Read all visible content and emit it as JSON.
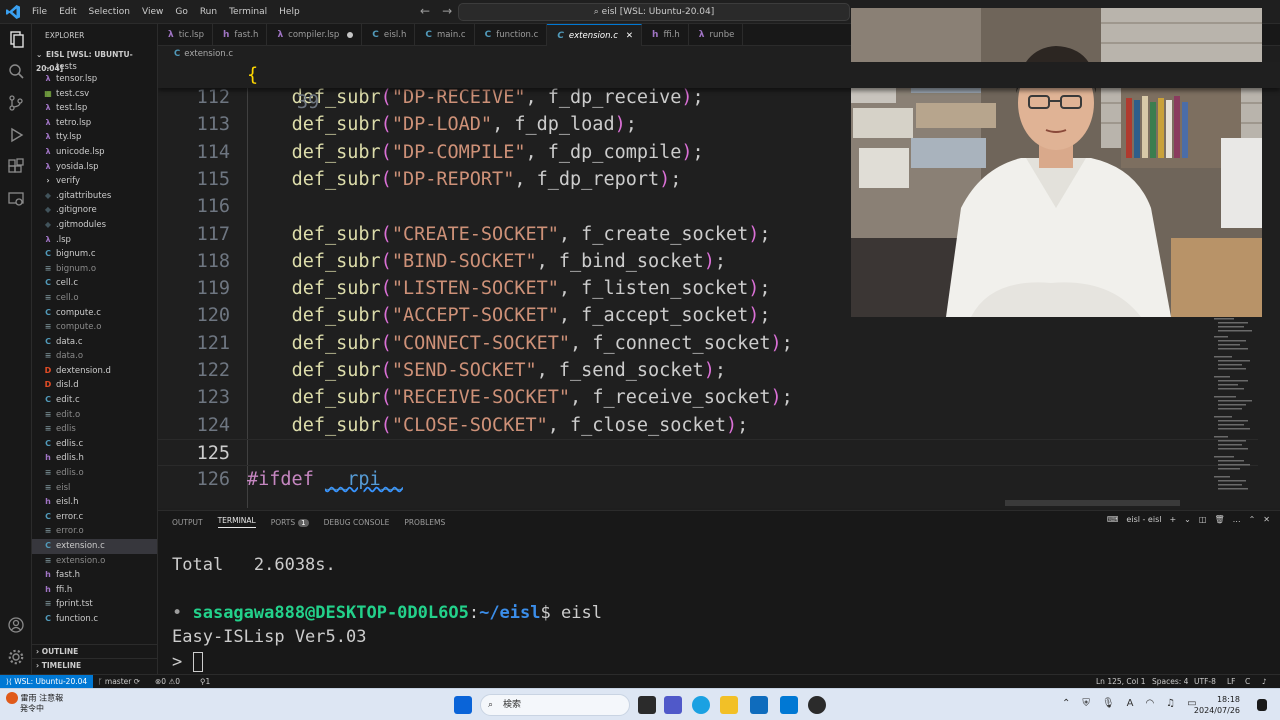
{
  "titlebar": {
    "menu": [
      "File",
      "Edit",
      "Selection",
      "View",
      "Go",
      "Run",
      "Terminal",
      "Help"
    ],
    "command_center": "eisl [WSL: Ubuntu-20.04]"
  },
  "sidebar": {
    "title": "EXPLORER",
    "workspace": "EISL [WSL: UBUNTU-20.04]",
    "folder_open": "tests",
    "items": [
      {
        "icon": "λ",
        "icon_color": "#a074c4",
        "label": "tensor.lsp",
        "dim": false
      },
      {
        "icon": "▦",
        "icon_color": "#8bc34a",
        "label": "test.csv",
        "dim": false
      },
      {
        "icon": "λ",
        "icon_color": "#a074c4",
        "label": "test.lsp",
        "dim": false
      },
      {
        "icon": "λ",
        "icon_color": "#a074c4",
        "label": "tetro.lsp",
        "dim": false
      },
      {
        "icon": "λ",
        "icon_color": "#a074c4",
        "label": "tty.lsp",
        "dim": false
      },
      {
        "icon": "λ",
        "icon_color": "#a074c4",
        "label": "unicode.lsp",
        "dim": false
      },
      {
        "icon": "λ",
        "icon_color": "#a074c4",
        "label": "yosida.lsp",
        "dim": false
      },
      {
        "icon": "›",
        "icon_color": "#cccccc",
        "label": "verify",
        "dim": false
      },
      {
        "icon": "◆",
        "icon_color": "#41535b",
        "label": ".gitattributes",
        "dim": false
      },
      {
        "icon": "◆",
        "icon_color": "#41535b",
        "label": ".gitignore",
        "dim": false
      },
      {
        "icon": "◆",
        "icon_color": "#41535b",
        "label": ".gitmodules",
        "dim": false
      },
      {
        "icon": "λ",
        "icon_color": "#a074c4",
        "label": ".lsp",
        "dim": false
      },
      {
        "icon": "C",
        "icon_color": "#519aba",
        "label": "bignum.c",
        "dim": false
      },
      {
        "icon": "≡",
        "icon_color": "#6d8086",
        "label": "bignum.o",
        "dim": true
      },
      {
        "icon": "C",
        "icon_color": "#519aba",
        "label": "cell.c",
        "dim": false
      },
      {
        "icon": "≡",
        "icon_color": "#6d8086",
        "label": "cell.o",
        "dim": true
      },
      {
        "icon": "C",
        "icon_color": "#519aba",
        "label": "compute.c",
        "dim": false
      },
      {
        "icon": "≡",
        "icon_color": "#6d8086",
        "label": "compute.o",
        "dim": true
      },
      {
        "icon": "C",
        "icon_color": "#519aba",
        "label": "data.c",
        "dim": false
      },
      {
        "icon": "≡",
        "icon_color": "#6d8086",
        "label": "data.o",
        "dim": true
      },
      {
        "icon": "D",
        "icon_color": "#e44d26",
        "label": "dextension.d",
        "dim": false
      },
      {
        "icon": "D",
        "icon_color": "#e44d26",
        "label": "disl.d",
        "dim": false
      },
      {
        "icon": "C",
        "icon_color": "#519aba",
        "label": "edit.c",
        "dim": false
      },
      {
        "icon": "≡",
        "icon_color": "#6d8086",
        "label": "edit.o",
        "dim": true
      },
      {
        "icon": "≡",
        "icon_color": "#6d8086",
        "label": "edlis",
        "dim": true
      },
      {
        "icon": "C",
        "icon_color": "#519aba",
        "label": "edlis.c",
        "dim": false
      },
      {
        "icon": "h",
        "icon_color": "#a074c4",
        "label": "edlis.h",
        "dim": false
      },
      {
        "icon": "≡",
        "icon_color": "#6d8086",
        "label": "edlis.o",
        "dim": true
      },
      {
        "icon": "≡",
        "icon_color": "#6d8086",
        "label": "eisl",
        "dim": true
      },
      {
        "icon": "h",
        "icon_color": "#a074c4",
        "label": "eisl.h",
        "dim": false
      },
      {
        "icon": "C",
        "icon_color": "#519aba",
        "label": "error.c",
        "dim": false
      },
      {
        "icon": "≡",
        "icon_color": "#6d8086",
        "label": "error.o",
        "dim": true
      },
      {
        "icon": "C",
        "icon_color": "#519aba",
        "label": "extension.c",
        "dim": false,
        "selected": true
      },
      {
        "icon": "≡",
        "icon_color": "#6d8086",
        "label": "extension.o",
        "dim": true
      },
      {
        "icon": "h",
        "icon_color": "#a074c4",
        "label": "fast.h",
        "dim": false
      },
      {
        "icon": "h",
        "icon_color": "#a074c4",
        "label": "ffi.h",
        "dim": false
      },
      {
        "icon": "≡",
        "icon_color": "#6d8086",
        "label": "fprint.tst",
        "dim": false
      },
      {
        "icon": "C",
        "icon_color": "#519aba",
        "label": "function.c",
        "dim": false
      }
    ],
    "outline": "OUTLINE",
    "timeline": "TIMELINE"
  },
  "tabs": [
    {
      "icon": "λ",
      "icon_color": "#a074c4",
      "label": "tic.lsp"
    },
    {
      "icon": "h",
      "icon_color": "#a074c4",
      "label": "fast.h"
    },
    {
      "icon": "λ",
      "icon_color": "#a074c4",
      "label": "compiler.lsp",
      "modified": true
    },
    {
      "icon": "C",
      "icon_color": "#519aba",
      "label": "eisl.h"
    },
    {
      "icon": "C",
      "icon_color": "#519aba",
      "label": "main.c"
    },
    {
      "icon": "C",
      "icon_color": "#519aba",
      "label": "function.c"
    },
    {
      "icon": "C",
      "icon_color": "#519aba",
      "label": "extension.c",
      "active": true
    },
    {
      "icon": "h",
      "icon_color": "#a074c4",
      "label": "ffi.h"
    },
    {
      "icon": "λ",
      "icon_color": "#a074c4",
      "label": "runbe"
    }
  ],
  "breadcrumb": {
    "icon": "C",
    "label": "extension.c"
  },
  "editor": {
    "sticky": {
      "ln": "39",
      "text": "{"
    },
    "lines": [
      {
        "ln": "112",
        "fn": "def_subr",
        "name": "\"DP-RECEIVE\"",
        "arg": "f_dp_receive"
      },
      {
        "ln": "113",
        "fn": "def_subr",
        "name": "\"DP-LOAD\"",
        "arg": "f_dp_load"
      },
      {
        "ln": "114",
        "fn": "def_subr",
        "name": "\"DP-COMPILE\"",
        "arg": "f_dp_compile"
      },
      {
        "ln": "115",
        "fn": "def_subr",
        "name": "\"DP-REPORT\"",
        "arg": "f_dp_report"
      },
      {
        "ln": "116",
        "blank": true
      },
      {
        "ln": "117",
        "fn": "def_subr",
        "name": "\"CREATE-SOCKET\"",
        "arg": "f_create_socket"
      },
      {
        "ln": "118",
        "fn": "def_subr",
        "name": "\"BIND-SOCKET\"",
        "arg": "f_bind_socket"
      },
      {
        "ln": "119",
        "fn": "def_subr",
        "name": "\"LISTEN-SOCKET\"",
        "arg": "f_listen_socket"
      },
      {
        "ln": "120",
        "fn": "def_subr",
        "name": "\"ACCEPT-SOCKET\"",
        "arg": "f_accept_socket"
      },
      {
        "ln": "121",
        "fn": "def_subr",
        "name": "\"CONNECT-SOCKET\"",
        "arg": "f_connect_socket"
      },
      {
        "ln": "122",
        "fn": "def_subr",
        "name": "\"SEND-SOCKET\"",
        "arg": "f_send_socket"
      },
      {
        "ln": "123",
        "fn": "def_subr",
        "name": "\"RECEIVE-SOCKET\"",
        "arg": "f_receive_socket"
      },
      {
        "ln": "124",
        "fn": "def_subr",
        "name": "\"CLOSE-SOCKET\"",
        "arg": "f_close_socket"
      },
      {
        "ln": "125",
        "blank": true,
        "current": true
      },
      {
        "ln": "126",
        "directive": "#ifdef",
        "macro": "__rpi__"
      }
    ]
  },
  "panel": {
    "tabs": [
      "OUTPUT",
      "TERMINAL",
      "PORTS",
      "DEBUG CONSOLE",
      "PROBLEMS"
    ],
    "ports_badge": "1",
    "terminal_name": "eisl - eisl",
    "terminal": {
      "total": "Total   2.6038s.",
      "user": "sasagawa888@DESKTOP-0D0L6O5",
      "path": "~/eisl",
      "command": "eisl",
      "output": "Easy-ISLisp Ver5.03",
      "prompt": ">"
    }
  },
  "statusbar": {
    "remote": "WSL: Ubuntu-20.04",
    "branch": "master",
    "errors": "0",
    "warnings": "0",
    "ports": "1",
    "position": "Ln 125, Col 1",
    "spaces": "Spaces: 4",
    "encoding": "UTF-8",
    "eol": "LF",
    "language": "C"
  },
  "taskbar": {
    "weather_line1": "雷雨 注意報",
    "weather_line2": "発令中",
    "search": "検索",
    "ime": "A",
    "time": "18:18",
    "date": "2024/07/26"
  },
  "colors": {
    "accent": "#0078d4",
    "editor_bg": "#1f1f1f"
  }
}
